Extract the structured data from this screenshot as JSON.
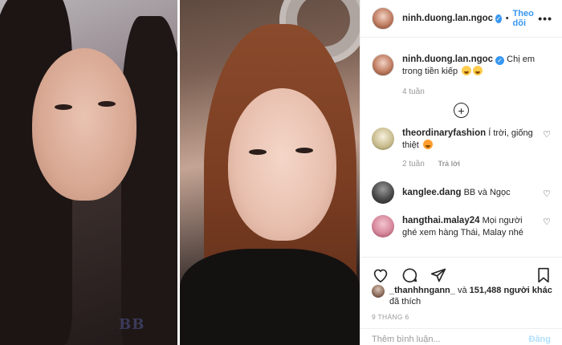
{
  "header": {
    "username": "ninh.duong.lan.ngoc",
    "separator": "•",
    "follow_label": "Theo dõi",
    "more_label": "•••"
  },
  "caption": {
    "username": "ninh.duong.lan.ngoc",
    "text": "Chị em trong tiền kiếp",
    "time": "4 tuần"
  },
  "comments": [
    {
      "username": "theordinaryfashion",
      "text": "Í trời, giống thiệt",
      "time": "2 tuần",
      "reply_label": "Trả lời"
    },
    {
      "username": "kanglee.dang",
      "text": "BB và Ngọc"
    },
    {
      "username": "hangthai.malay24",
      "text": "Mọi người ghé xem hàng Thái, Malay nhé"
    }
  ],
  "likes": {
    "liker": "_thanhhngann_",
    "connector": "và",
    "count": "151,488",
    "others_label": "người khác",
    "suffix": "đã thích"
  },
  "date": "9 THÁNG 6",
  "add_comment": {
    "placeholder": "Thêm bình luận...",
    "post_label": "Đăng"
  },
  "photo": {
    "tattoo_text": "BB"
  },
  "colors": {
    "accent": "#3897f0",
    "post_disabled": "#b2dffc",
    "muted": "#999999",
    "text": "#262626"
  }
}
